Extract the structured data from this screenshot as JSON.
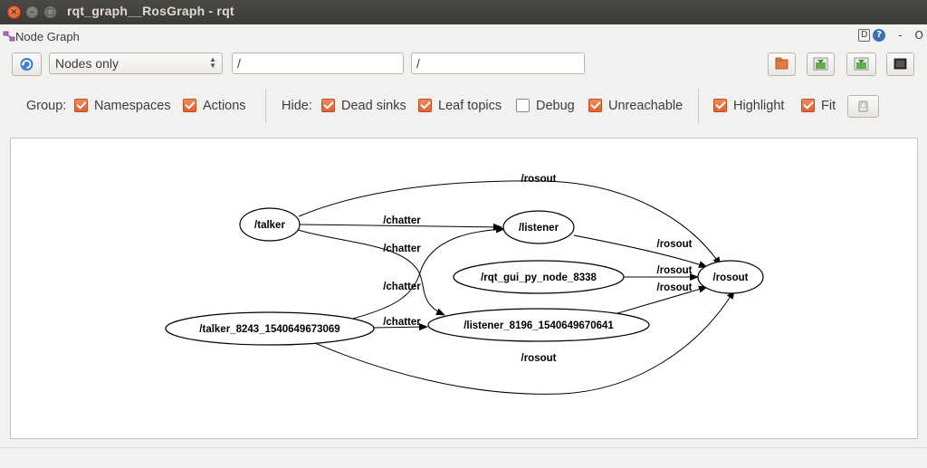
{
  "window": {
    "title": "rqt_graph__RosGraph - rqt",
    "close_glyph": "×",
    "min_glyph": "–",
    "max_glyph": "□"
  },
  "dock": {
    "title": "Node Graph",
    "d_label": "D",
    "help_label": "?",
    "minimize_label": "-",
    "close_label": "O"
  },
  "toolbar": {
    "refresh_icon": "refresh-icon",
    "mode_select": "Nodes only",
    "filter_ns": "/",
    "filter_topic": "/"
  },
  "options": {
    "group_label": "Group:",
    "namespaces_label": "Namespaces",
    "namespaces_checked": true,
    "actions_label": "Actions",
    "actions_checked": true,
    "hide_label": "Hide:",
    "dead_sinks_label": "Dead sinks",
    "dead_sinks_checked": true,
    "leaf_topics_label": "Leaf topics",
    "leaf_topics_checked": true,
    "debug_label": "Debug",
    "debug_checked": false,
    "unreachable_label": "Unreachable",
    "unreachable_checked": true,
    "highlight_label": "Highlight",
    "highlight_checked": true,
    "fit_label": "Fit",
    "fit_checked": true
  },
  "graph": {
    "nodes": {
      "talker": "/talker",
      "listener": "/listener",
      "rqt_gui": "/rqt_gui_py_node_8338",
      "rosout": "/rosout",
      "talker_8243": "/talker_8243_1540649673069",
      "listener_8196": "/listener_8196_1540649670641"
    },
    "edges": {
      "talker_rosout": "/rosout",
      "talker_listener": "/chatter",
      "talker_listener8196": "/chatter",
      "talker8243_listener": "/chatter",
      "talker8243_listener8196": "/chatter",
      "listener_rosout": "/rosout",
      "rqtgui_rosout": "/rosout",
      "listener8196_rosout": "/rosout",
      "talker8243_rosout": "/rosout"
    }
  }
}
